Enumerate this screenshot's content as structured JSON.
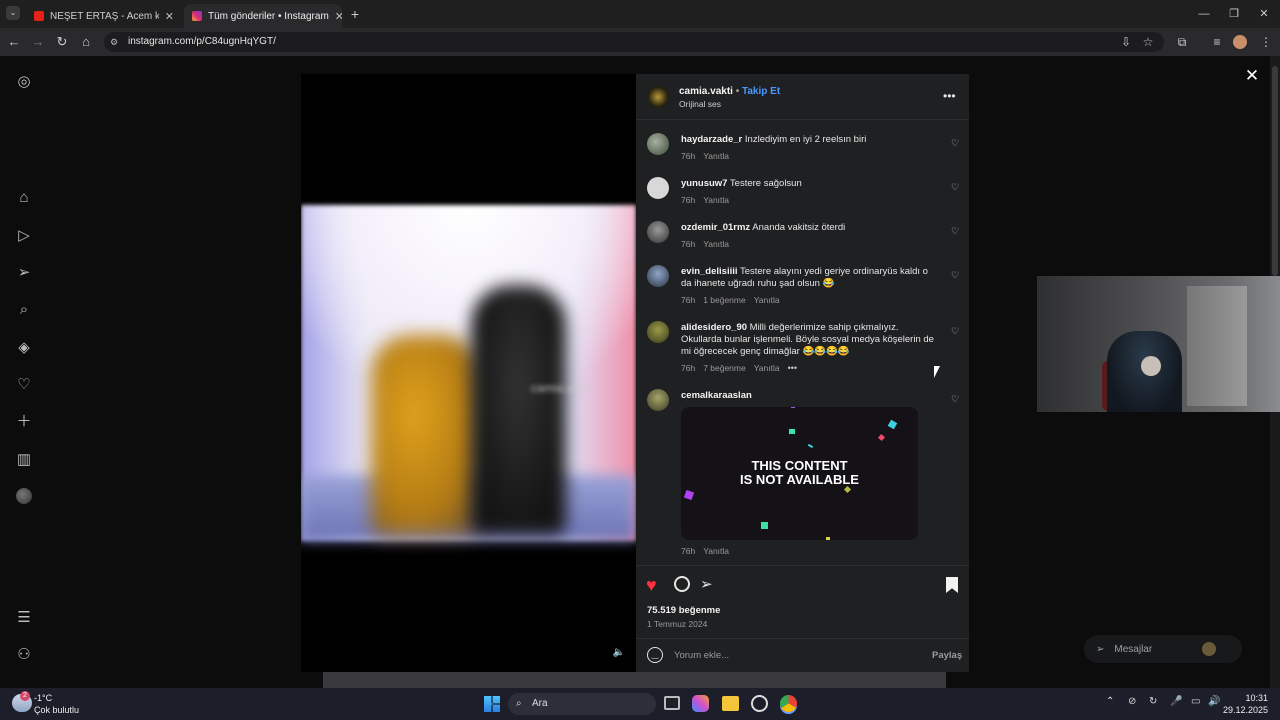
{
  "browser": {
    "tabs": [
      {
        "title": "NEŞET ERTAŞ - Acem kızı. Çırpın",
        "active": false
      },
      {
        "title": "Tüm gönderiler • Instagram",
        "active": true
      }
    ],
    "new_tab_label": "+",
    "url": "instagram.com/p/C84ugnHqYGT/"
  },
  "post": {
    "username": "camia.vakti",
    "follow_label": "Takip Et",
    "audio_label": "Orijinal ses",
    "watermark": "camia.vakti",
    "likes": "75.519 beğenme",
    "date": "1 Temmuz 2024",
    "comment_placeholder": "Yorum ekle...",
    "share_label": "Paylaş"
  },
  "comments": [
    {
      "user": "haydarzade_r",
      "text": "Inzlediyim en iyi 2 reelsın biri",
      "time": "76h",
      "likes": "",
      "reply": "Yanıtla"
    },
    {
      "user": "yunusuw7",
      "text": "Testere sağolsun",
      "time": "76h",
      "likes": "",
      "reply": "Yanıtla"
    },
    {
      "user": "ozdemir_01rmz",
      "text": "Ananda vakitsiz öterdi",
      "time": "76h",
      "likes": "",
      "reply": "Yanıtla"
    },
    {
      "user": "evin_delisiiii",
      "text": "Testere alayını yedi geriye ordinaryüs kaldı o da ihanete uğradı ruhu şad olsun 😂",
      "time": "76h",
      "likes": "1 beğenme",
      "reply": "Yanıtla"
    },
    {
      "user": "alidesidero_90",
      "text": "Milli değerlerimize sahip çıkmalıyız. Okullarda bunlar işlenmeli. Böyle sosyal medya köşelerin de mi öğrececek genç dimağlar 😂😂😂😂",
      "time": "76h",
      "likes": "7 beğenme",
      "reply": "Yanıtla"
    },
    {
      "user": "cemalkaraaslan",
      "text": "",
      "time": "76h",
      "likes": "",
      "reply": "Yanıtla"
    }
  ],
  "unavailable": {
    "line1": "THIS CONTENT",
    "line2": "IS NOT AVAILABLE"
  },
  "messages_label": "Mesajlar",
  "taskbar": {
    "weather_temp": "-1°C",
    "weather_desc": "Çok bulutlu",
    "search_label": "Ara",
    "time": "10:31",
    "date": "29.12.2025",
    "badge": "2"
  },
  "icons": [
    "instagram-icon",
    "home-icon",
    "reels-icon",
    "send-icon",
    "search-icon",
    "explore-icon",
    "heart-icon",
    "create-icon",
    "insights-icon",
    "profile-avatar",
    "menu-icon",
    "threads-icon",
    "close-icon",
    "more-icon",
    "comment-icon",
    "bookmark-icon",
    "emoji-icon"
  ]
}
